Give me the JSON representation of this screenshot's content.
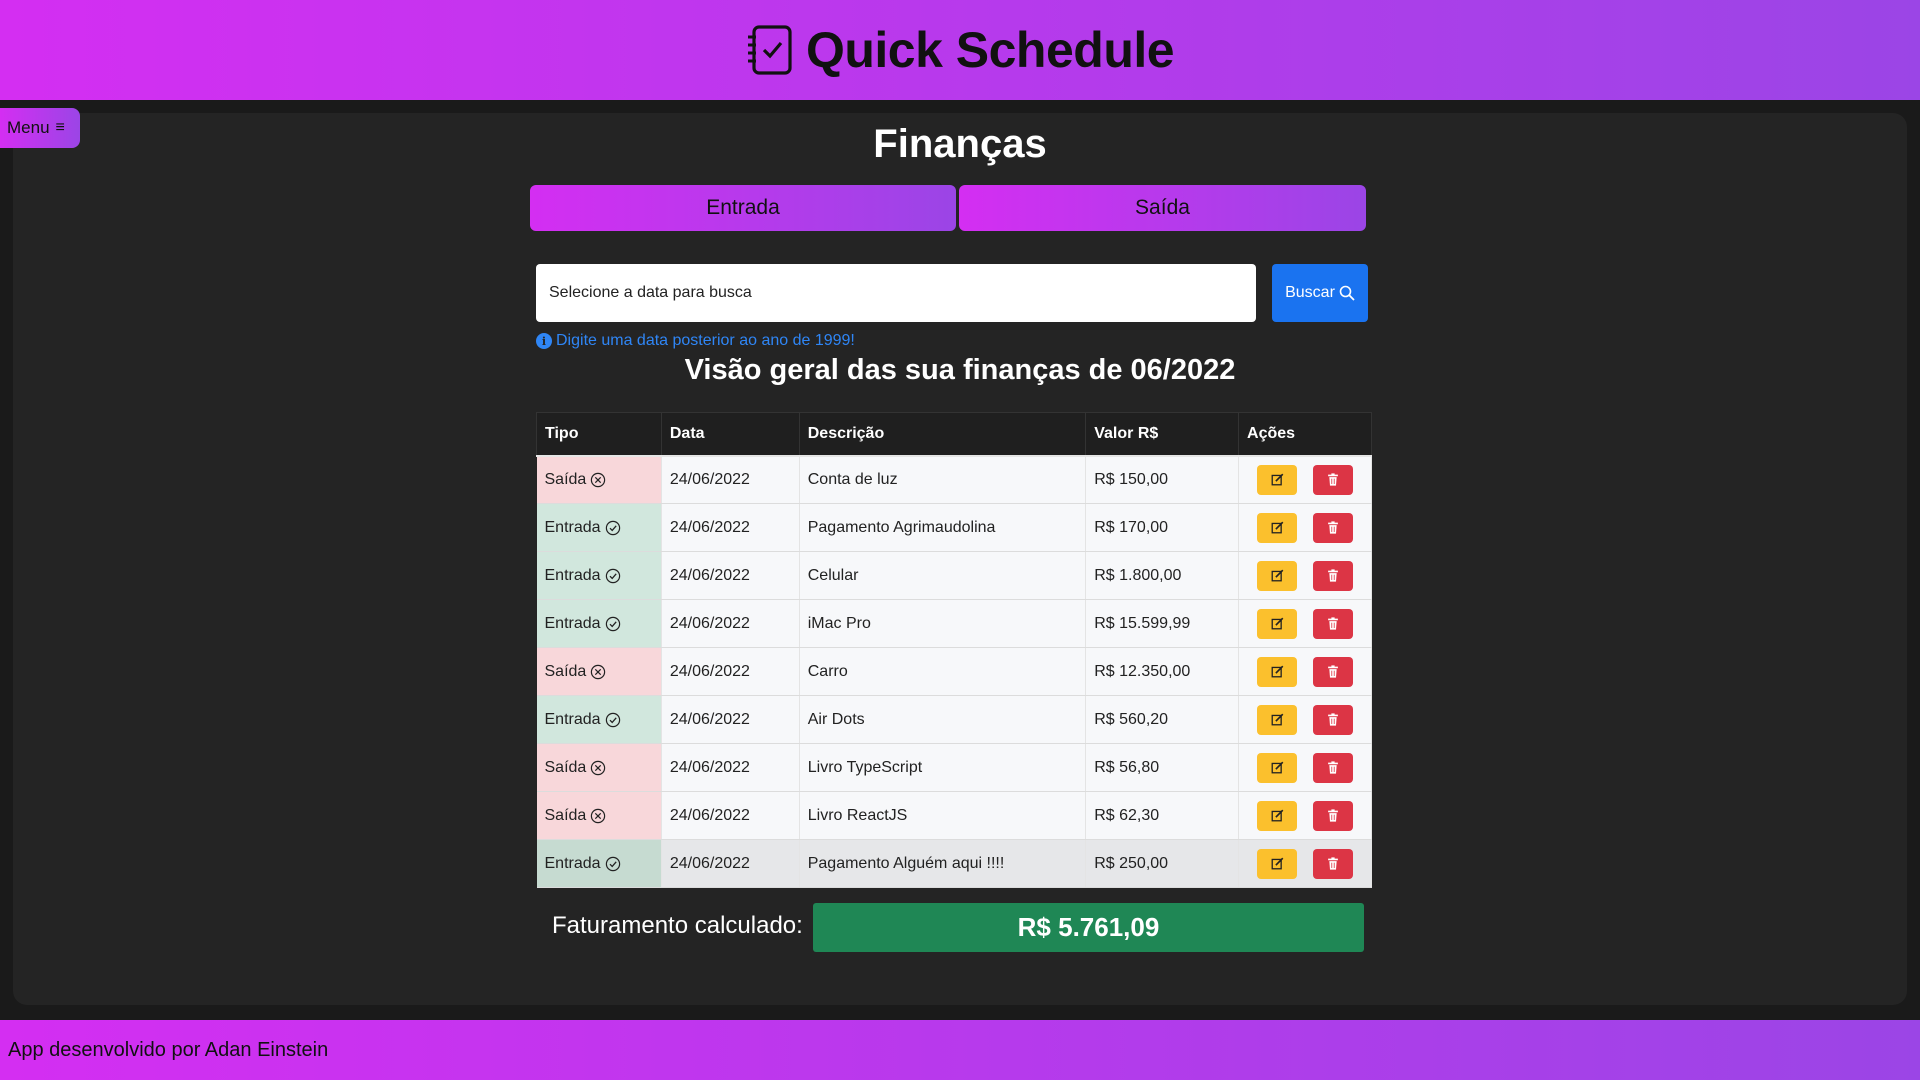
{
  "header": {
    "title": "Quick Schedule",
    "icon": "checklist-notebook-icon"
  },
  "menu": {
    "label": "Menu"
  },
  "page": {
    "title": "Finanças"
  },
  "tabs": [
    {
      "label": "Entrada"
    },
    {
      "label": "Saída"
    }
  ],
  "search": {
    "placeholder": "Selecione a data para busca",
    "button_label": "Buscar",
    "hint": "Digite uma data posterior ao ano de 1999!"
  },
  "overview_title": "Visão geral das sua finanças de 06/2022",
  "table": {
    "headers": [
      "Tipo",
      "Data",
      "Descrição",
      "Valor R$",
      "Ações"
    ],
    "rows": [
      {
        "tipo": "Saída",
        "data": "24/06/2022",
        "descricao": "Conta de luz",
        "valor": "R$ 150,00"
      },
      {
        "tipo": "Entrada",
        "data": "24/06/2022",
        "descricao": "Pagamento Agrimaudolina",
        "valor": "R$ 170,00"
      },
      {
        "tipo": "Entrada",
        "data": "24/06/2022",
        "descricao": "Celular",
        "valor": "R$ 1.800,00"
      },
      {
        "tipo": "Entrada",
        "data": "24/06/2022",
        "descricao": "iMac Pro",
        "valor": "R$ 15.599,99"
      },
      {
        "tipo": "Saída",
        "data": "24/06/2022",
        "descricao": "Carro",
        "valor": "R$ 12.350,00"
      },
      {
        "tipo": "Entrada",
        "data": "24/06/2022",
        "descricao": "Air Dots",
        "valor": "R$ 560,20"
      },
      {
        "tipo": "Saída",
        "data": "24/06/2022",
        "descricao": "Livro TypeScript",
        "valor": "R$ 56,80"
      },
      {
        "tipo": "Saída",
        "data": "24/06/2022",
        "descricao": "Livro ReactJS",
        "valor": "R$ 62,30"
      },
      {
        "tipo": "Entrada",
        "data": "24/06/2022",
        "descricao": "Pagamento Alguém aqui !!!!",
        "valor": "R$ 250,00"
      }
    ]
  },
  "total": {
    "label": "Faturamento calculado:",
    "value": "R$ 5.761,09"
  },
  "footer": {
    "text": "App desenvolvido por Adan Einstein"
  },
  "colors": {
    "gradient_start": "#d42ef2",
    "gradient_end": "#9b45e6",
    "search_button": "#1a73f0",
    "edit_button": "#fbc02d",
    "delete_button": "#dc3545",
    "total_box": "#1f8755",
    "row_saida": "#f8d7da",
    "row_entrada": "#d1e7dd"
  }
}
